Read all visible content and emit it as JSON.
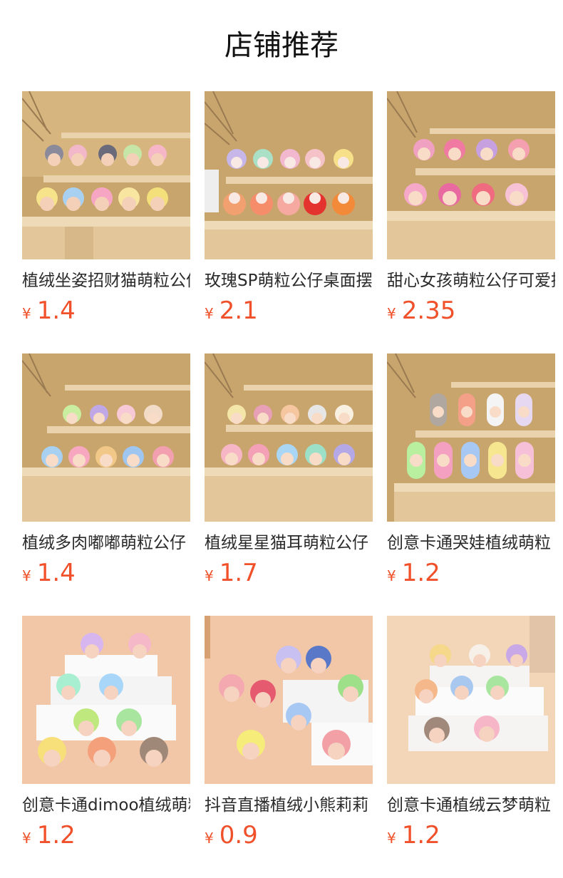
{
  "section": {
    "title": "店铺推荐"
  },
  "products": [
    {
      "name": "植绒坐姿招财猫萌粒公仔",
      "currency": "¥",
      "price": "1.4",
      "image": "plush-cat-figurines-on-wooden-shelf"
    },
    {
      "name": "玫瑰SP萌粒公仔桌面摆件",
      "currency": "¥",
      "price": "2.1",
      "image": "rose-figurines-on-wooden-shelf"
    },
    {
      "name": "甜心女孩萌粒公仔可爱摆件",
      "currency": "¥",
      "price": "2.35",
      "image": "sweetheart-girl-figurines-on-wooden-shelf"
    },
    {
      "name": "植绒多肉嘟嘟萌粒公仔",
      "currency": "¥",
      "price": "1.4",
      "image": "succulent-bunny-figurines-on-wooden-shelf"
    },
    {
      "name": "植绒星星猫耳萌粒公仔",
      "currency": "¥",
      "price": "1.7",
      "image": "star-cat-ear-figurines-on-wooden-shelf"
    },
    {
      "name": "创意卡通哭娃植绒萌粒",
      "currency": "¥",
      "price": "1.2",
      "image": "crying-bunny-figurines-on-wooden-shelf"
    },
    {
      "name": "创意卡通dimoo植绒萌粒",
      "currency": "¥",
      "price": "1.2",
      "image": "dimoo-figurines-on-white-steps"
    },
    {
      "name": "抖音直播植绒小熊莉莉",
      "currency": "¥",
      "price": "0.9",
      "image": "bear-figurines-on-white-steps"
    },
    {
      "name": "创意卡通植绒云梦萌粒",
      "currency": "¥",
      "price": "1.2",
      "image": "cloud-dream-figurines-on-white-steps"
    }
  ],
  "colors": {
    "price": "#f0502a"
  }
}
